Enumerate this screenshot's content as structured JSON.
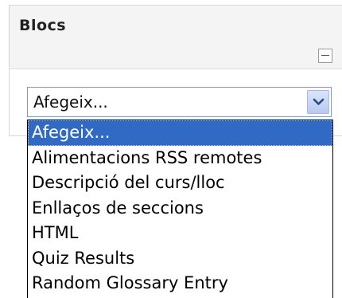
{
  "block": {
    "title": "Blocs"
  },
  "add_block": {
    "selected_value": "Afegeix...",
    "options": [
      "Afegeix...",
      "Alimentacions RSS remotes",
      "Descripció del curs/lloc",
      "Enllaços de seccions",
      "HTML",
      "Quiz Results",
      "Random Glossary Entry"
    ],
    "highlighted_index": 0
  },
  "colors": {
    "highlight": "#316ac5",
    "header_bg": "#f4f4f4"
  }
}
